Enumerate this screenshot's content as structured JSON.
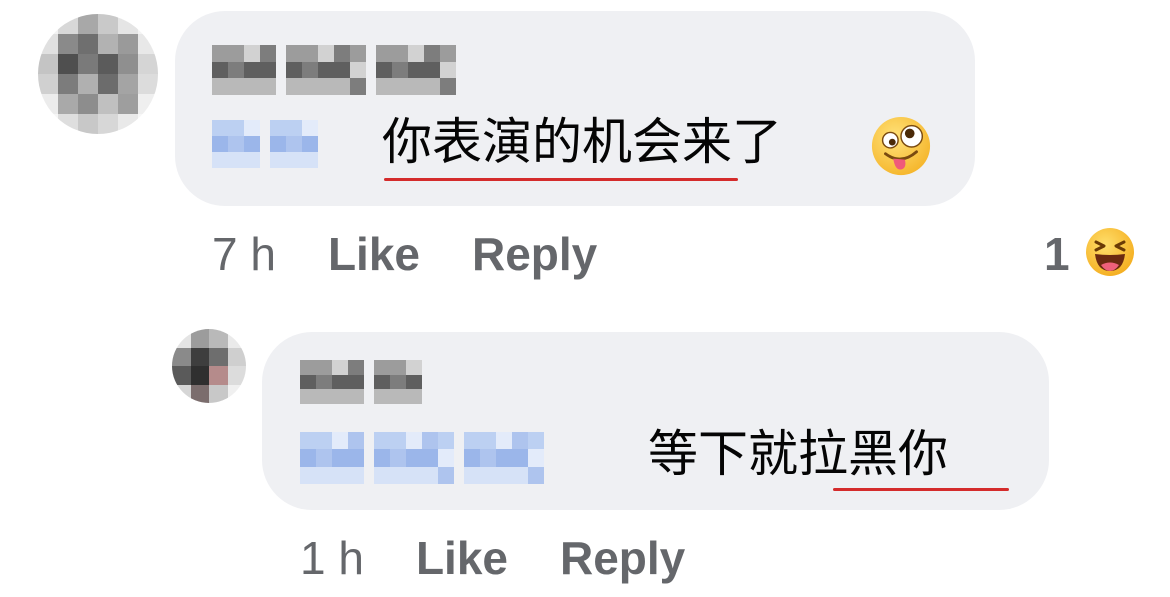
{
  "comments": [
    {
      "author": "",
      "mention": "",
      "text": "你表演的机会来了",
      "emoji": "zany-face-emoji",
      "time": "7 h",
      "like_label": "Like",
      "reply_label": "Reply",
      "reaction_count": "1",
      "reaction_icon": "laughing-face-emoji"
    },
    {
      "author": "",
      "mention": "",
      "text": "等下就拉黑你",
      "time": "1 h",
      "like_label": "Like",
      "reply_label": "Reply"
    }
  ],
  "colors": {
    "bubble": "#eff0f3",
    "meta_text": "#65676b",
    "body_text": "#050505",
    "spellcheck": "#d42b2b"
  }
}
